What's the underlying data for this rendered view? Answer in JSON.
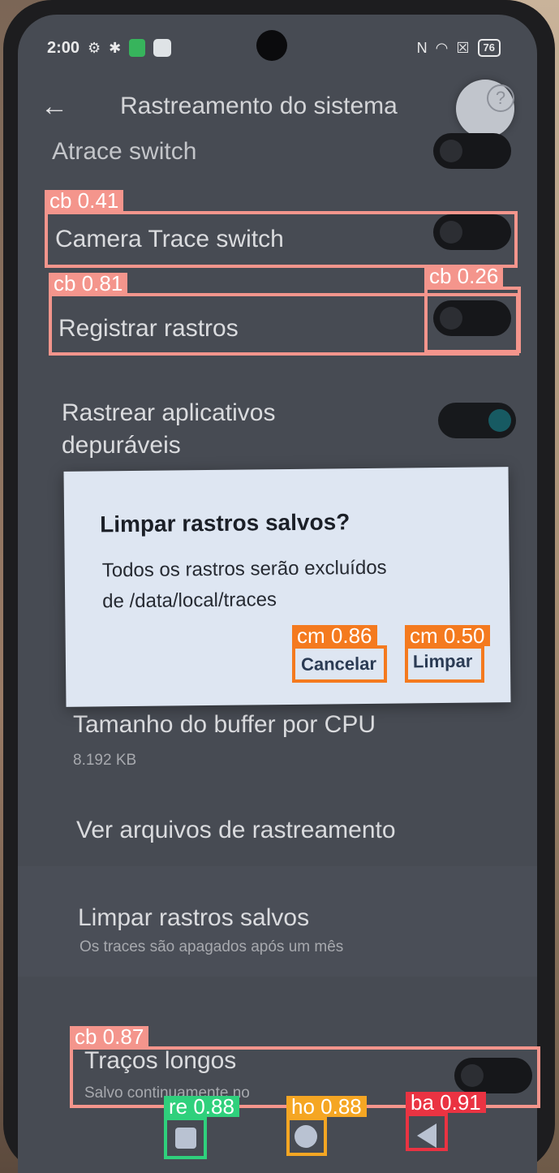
{
  "status_bar": {
    "time": "2:00",
    "battery": "76"
  },
  "header": {
    "back_icon": "arrow-left-icon",
    "title": "Rastreamento do sistema",
    "help_glyph": "?"
  },
  "settings": {
    "atrace": {
      "label": "Atrace switch",
      "on": false
    },
    "camera": {
      "label": "Camera Trace switch",
      "on": false
    },
    "registrar": {
      "label": "Registrar rastros",
      "on": false
    },
    "debuggable": {
      "label_line1": "Rastrear aplicativos",
      "label_line2": "depuráveis",
      "on": true
    },
    "buffer": {
      "label": "Tamanho do buffer por CPU",
      "value": "8.192 KB"
    },
    "view_files": {
      "label": "Ver arquivos de rastreamento"
    },
    "clear_saved": {
      "label": "Limpar rastros salvos",
      "subtitle": "Os traces são apagados após um mês"
    },
    "long_traces": {
      "label": "Traços longos",
      "subtitle": "Salvo continuamente no",
      "on": false
    }
  },
  "dialog": {
    "title": "Limpar rastros salvos?",
    "message_line1": "Todos os rastros serão excluídos",
    "message_line2": "de /data/local/traces",
    "cancel_label": "Cancelar",
    "confirm_label": "Limpar"
  },
  "detections": [
    {
      "label": "cb 0.41",
      "color": "#f4958c"
    },
    {
      "label": "cb 0.81",
      "color": "#f4958c"
    },
    {
      "label": "cb 0.26",
      "color": "#f4958c"
    },
    {
      "label": "cm 0.86",
      "color": "#f47a1f"
    },
    {
      "label": "cm 0.50",
      "color": "#f47a1f"
    },
    {
      "label": "cb 0.87",
      "color": "#f4958c"
    },
    {
      "label": "re 0.88",
      "color": "#2fd07c"
    },
    {
      "label": "ho 0.88",
      "color": "#f5a623"
    },
    {
      "label": "ba 0.91",
      "color": "#ea3342"
    }
  ],
  "nav": {
    "recents_icon": "square-icon",
    "home_icon": "circle-icon",
    "back_icon": "triangle-back-icon"
  }
}
